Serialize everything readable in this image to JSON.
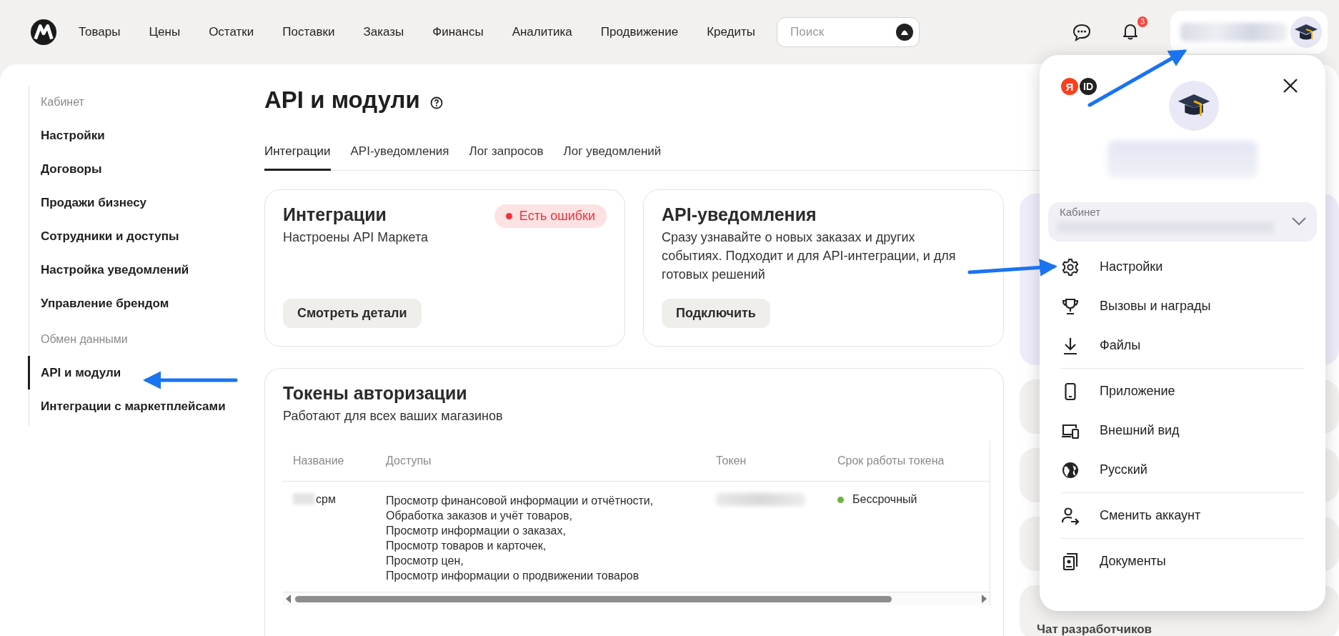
{
  "top_bar": {
    "nav": [
      {
        "label": "Товары"
      },
      {
        "label": "Цены"
      },
      {
        "label": "Остатки"
      },
      {
        "label": "Поставки"
      },
      {
        "label": "Заказы"
      },
      {
        "label": "Финансы"
      },
      {
        "label": "Аналитика"
      },
      {
        "label": "Продвижение"
      },
      {
        "label": "Кредиты"
      }
    ],
    "search": {
      "placeholder": "Поиск"
    },
    "notifications": {
      "badge": "3"
    }
  },
  "sidebar": {
    "groups": [
      {
        "heading": "Кабинет",
        "items": [
          {
            "label": "Настройки",
            "selected": false
          },
          {
            "label": "Договоры",
            "selected": false
          },
          {
            "label": "Продажи бизнесу",
            "selected": false
          },
          {
            "label": "Сотрудники и доступы",
            "selected": false
          },
          {
            "label": "Настройка уведомлений",
            "selected": false
          },
          {
            "label": "Управление брендом",
            "selected": false
          }
        ]
      },
      {
        "heading": "Обмен данными",
        "items": [
          {
            "label": "API и модули",
            "selected": true
          },
          {
            "label": "Интеграции с маркетплейсами",
            "selected": false
          }
        ]
      }
    ]
  },
  "page": {
    "title": "API и модули",
    "tabs": [
      {
        "label": "Интеграции",
        "selected": true
      },
      {
        "label": "API-уведомления",
        "selected": false
      },
      {
        "label": "Лог запросов",
        "selected": false
      },
      {
        "label": "Лог уведомлений",
        "selected": false
      }
    ],
    "cards": [
      {
        "title": "Интеграции",
        "description": "Настроены API Маркета",
        "status": {
          "label": "Есть ошибки",
          "color": "#f0323c"
        },
        "button": "Смотреть детали"
      },
      {
        "title": "API-уведомления",
        "description": "Сразу узнавайте о новых заказах и других событиях. Подходит и для API-интеграции, и для готовых решений",
        "button": "Подключить"
      }
    ],
    "tokens": {
      "title": "Токены авторизации",
      "subtitle": "Работают для всех ваших магазинов",
      "columns": [
        "Название",
        "Доступы",
        "Токен",
        "Срок работы токена"
      ],
      "rows": [
        {
          "name": "срм",
          "accesses": [
            "Просмотр финансовой информации и отчётности,",
            "Обработка заказов и учёт товаров,",
            "Просмотр информации о заказах,",
            "Просмотр товаров и карточек,",
            "Просмотр цен,",
            "Просмотр информации о продвижении товаров"
          ],
          "expiry": {
            "label": "Бессрочный",
            "color": "#6bb43c"
          }
        }
      ]
    }
  },
  "right_panel": {
    "cards": [
      {
        "kind": "promo"
      },
      {
        "kind": "plain"
      },
      {
        "kind": "plain"
      },
      {
        "kind": "plain"
      },
      {
        "kind": "plain",
        "title": "Чат разработчиков"
      }
    ]
  },
  "profile_menu": {
    "id_logo": {
      "letter": "Я",
      "text": "ID"
    },
    "cabinet": {
      "label": "Кабинет"
    },
    "groups": [
      [
        {
          "kind": "settings",
          "label": "Настройки"
        },
        {
          "kind": "trophy",
          "label": "Вызовы и награды"
        },
        {
          "kind": "download",
          "label": "Файлы"
        }
      ],
      [
        {
          "kind": "phone",
          "label": "Приложение"
        },
        {
          "kind": "devices",
          "label": "Внешний вид"
        },
        {
          "kind": "globe",
          "label": "Русский"
        }
      ],
      [
        {
          "kind": "switch",
          "label": "Сменить аккаунт"
        }
      ],
      [
        {
          "kind": "documents",
          "label": "Документы"
        }
      ]
    ]
  }
}
